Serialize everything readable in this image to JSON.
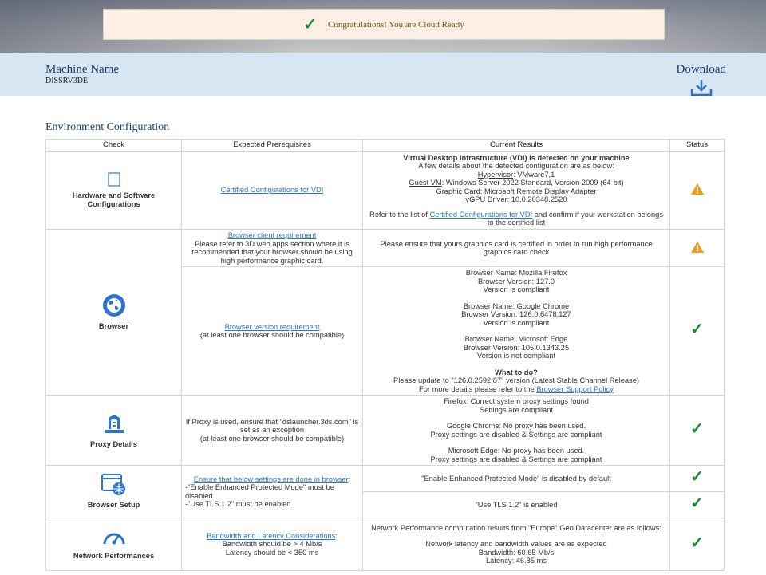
{
  "banner": {
    "message": "Congratulations! You are Cloud Ready",
    "icon": "check-icon"
  },
  "machine": {
    "title": "Machine Name",
    "value": "DISSRV3DE"
  },
  "download": {
    "label": "Download",
    "icon": "download-icon"
  },
  "section_title": "Environment Configuration",
  "table": {
    "headers": [
      "Check",
      "Expected Prerequisites",
      "Current Results",
      "Status"
    ],
    "hw": {
      "name": "Hardware and Software Configurations",
      "prereq_link": "Certified Configurations for VDI",
      "result_heading": "Virtual Desktop Infrastructure (VDI) is detected on your machine",
      "result_intro": "A few details about the detected configuration are as below:",
      "hypervisor_label": "Hypervisor",
      "hypervisor_value": ": VMware7,1",
      "guestvm_label": "Guest VM",
      "guestvm_value": ": Windows Server 2022 Standard, Version 2009 (64-bit)",
      "graphic_label": "Graphic Card",
      "graphic_value": ": Microsoft Remote Display Adapter",
      "vgpu_label": "vGPU Driver",
      "vgpu_value": ": 10.0.20348.2520",
      "refer_pre": "Refer to the list of ",
      "refer_link": "Certified Configurations for VDI",
      "refer_post": " and confirm if your workstation belongs to the certified list",
      "status": "warning"
    },
    "browser": {
      "name": "Browser",
      "req1_link": "Browser client requirement",
      "req1_text": "Please refer to 3D web apps section where it is recommended that your browser should be using high performance graphic card.",
      "res1": "Please ensure that yours graphics card is certified in order to run high performance graphics card check",
      "status1": "warning",
      "req2_link": "Browser version requirement",
      "req2_text": "(at least one browser should be compatible)",
      "ff_name": "Browser Name: Mozilla Firefox",
      "ff_ver": "Browser Version: 127.0",
      "ff_state": "Version is compliant",
      "gc_name": "Browser Name: Google Chrome",
      "gc_ver": "Browser Version: 126.0.6478.127",
      "gc_state": "Version is compliant",
      "me_name": "Browser Name: Microsoft Edge",
      "me_ver": "Browser Version: 105.0.1343.25",
      "me_state": "Version is not compliant",
      "todo_title": "What to do?",
      "todo_text": "Please update to \"126.0.2592.87\" version (Latest Stable Channel Release)",
      "todo_more": "For more details please refer to the ",
      "todo_link": "Browser Support Policy",
      "status2": "ok"
    },
    "proxy": {
      "name": "Proxy Details",
      "req": "If Proxy is used, ensure that \"dslauncher.3ds.com\" is set as an exception",
      "req2": "(at least one browser should be compatible)",
      "ff1": "Firefox: Correct system proxy settings found",
      "ff2": "Settings are compliant",
      "gc1": "Google Chrome: No proxy has been used.",
      "gc2": "Proxy settings are disabled & Settings are compliant",
      "me1": "Microsoft Edge: No proxy has been used.",
      "me2": "Proxy settings are disabled & Settings are compliant",
      "status": "ok"
    },
    "setup": {
      "name": "Browser Setup",
      "req_link": "Ensure that below settings are done in browser",
      "req_colon": ":",
      "req_l1": "-\"Enable Enhanced Protected Mode\" must be disabled",
      "req_l2": "-\"Use TLS 1.2\" must be enabled",
      "res1": "\"Enable Enhanced Protected Mode\" is disabled by default",
      "res2": "\"Use TLS 1.2\" is enabled",
      "status1": "ok",
      "status2": "ok"
    },
    "network": {
      "name": "Network Performances",
      "req_link": "Bandwidth and Latency Considerations",
      "req_colon": ":",
      "req_l1": "Bandwidth should be > 4 Mb/s",
      "req_l2": "Latency should be < 350 ms",
      "res1": "Network Performance computation results from \"Europe\" Geo Datacenter are as follows:",
      "res2": "Network latency and bandwidth values are as expected",
      "res3": "Bandwidth: 60.65 Mb/s",
      "res4": "Latency: 46.85 ms",
      "status": "ok"
    }
  },
  "colors": {
    "accent": "#1b3f66",
    "link": "#2a74c9",
    "ok": "#1d8a2e",
    "warn": "#f39c12",
    "header_bg": "#d6e6f3",
    "banner_bg": "#fbefe6"
  }
}
